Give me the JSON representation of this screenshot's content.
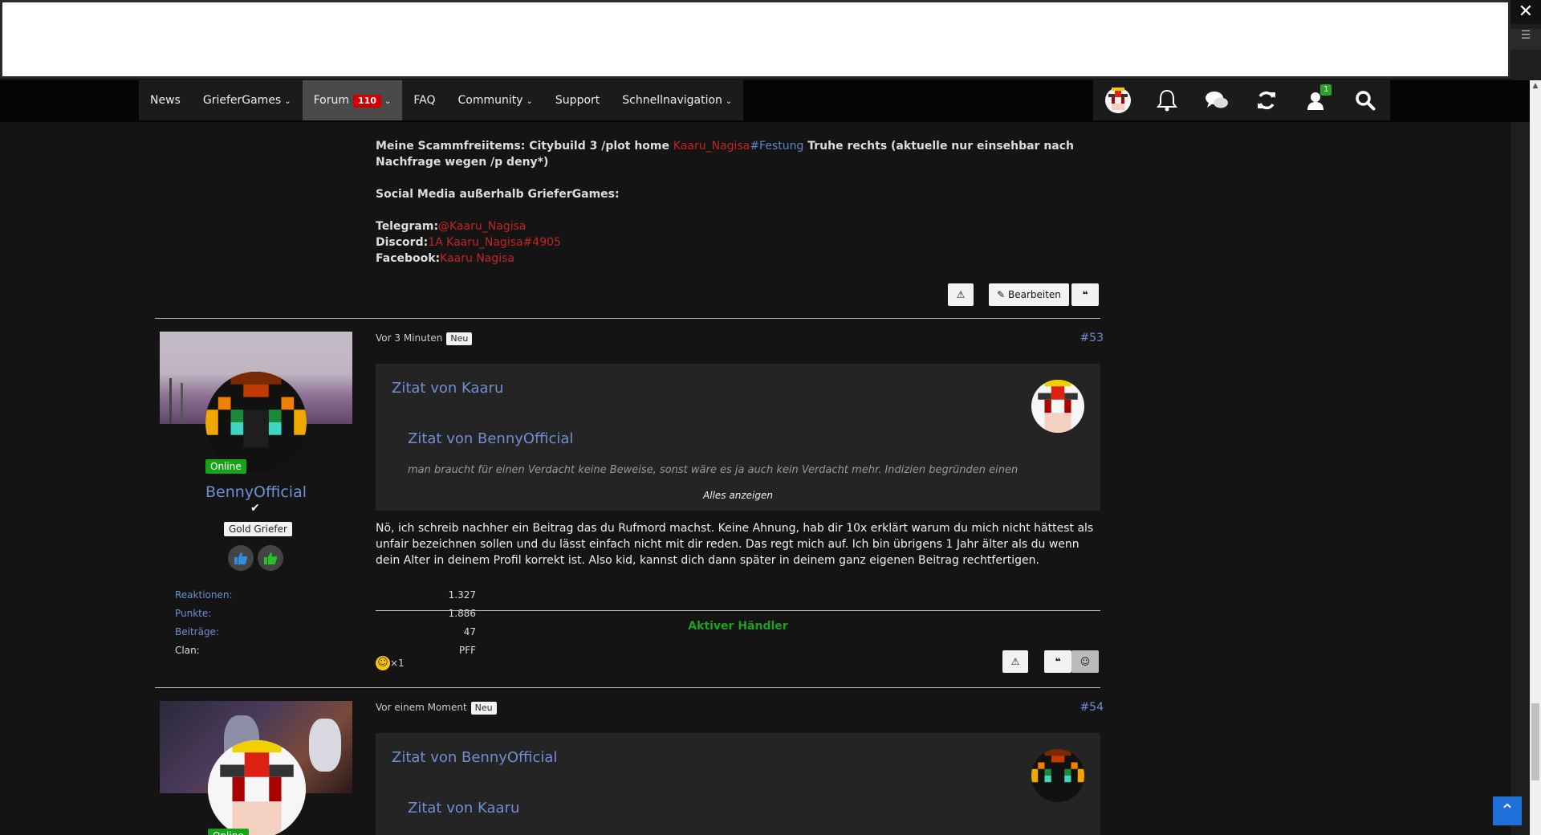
{
  "window": {
    "close_icon": "close-icon",
    "menu_icon": "hamburger-icon"
  },
  "nav": {
    "items": [
      {
        "label": "News"
      },
      {
        "label": "GrieferGames",
        "dropdown": true
      },
      {
        "label": "Forum",
        "badge": "110",
        "dropdown": true,
        "active": true
      },
      {
        "label": "FAQ"
      },
      {
        "label": "Community",
        "dropdown": true
      },
      {
        "label": "Support"
      },
      {
        "label": "Schnellnavigation",
        "dropdown": true
      }
    ],
    "friend_count": "1"
  },
  "post_top": {
    "scamm_label": "Meine Scammfreiitems: Citybuild 3 /plot home ",
    "scamm_red": "Kaaru_Nagisa",
    "scamm_blue": "#Festung",
    "scamm_rest": " Truhe rechts (aktuelle nur einsehbar nach Nachfrage wegen /p deny*)",
    "social_heading": "Social Media außerhalb GrieferGames:",
    "telegram_label": "Telegram:",
    "telegram_value": "@Kaaru_Nagisa",
    "discord_label": "Discord:",
    "discord_value": "1A Kaaru_Nagisa#4905",
    "facebook_label": "Facebook:",
    "facebook_value": "Kaaru Nagisa",
    "edit_label": "Bearbeiten"
  },
  "post53": {
    "user": {
      "name": "BennyOfficial",
      "status": "Online",
      "rank": "Gold Griefer",
      "stats": [
        {
          "label": "Reaktionen:",
          "value": "1.327"
        },
        {
          "label": "Punkte:",
          "value": "1.886"
        },
        {
          "label": "Beiträge:",
          "value": "47"
        },
        {
          "label": "Clan:",
          "value": "PFF"
        }
      ]
    },
    "time": "Vor 3 Minuten",
    "new_badge": "Neu",
    "number": "#53",
    "quote_outer_title": "Zitat von Kaaru",
    "quote_inner_title": "Zitat von BennyOfficial",
    "quote_inner_text": "man braucht für einen Verdacht keine Beweise, sonst wäre es ja auch kein Verdacht mehr. Indizien begründen einen",
    "show_all": "Alles anzeigen",
    "body": "Nö, ich schreib nachher ein Beitrag das du Rufmord machst. Keine Ahnung, hab dir 10x erklärt warum du mich nicht hättest als unfair bezeichnen sollen und du lässt einfach nicht mit dir reden. Das regt mich auf. Ich bin übrigens 1 Jahr älter als du wenn dein Alter in deinem Profil korrekt ist. Also kid, kannst dich dann später in deinem ganz eigenen Beitrag rechtfertigen.",
    "signature": "Aktiver Händler",
    "reaction_count": "×1"
  },
  "post54": {
    "time": "Vor einem Moment",
    "new_badge": "Neu",
    "number": "#54",
    "quote_outer_title": "Zitat von BennyOfficial",
    "quote_inner_title": "Zitat von Kaaru",
    "status": "Online"
  }
}
